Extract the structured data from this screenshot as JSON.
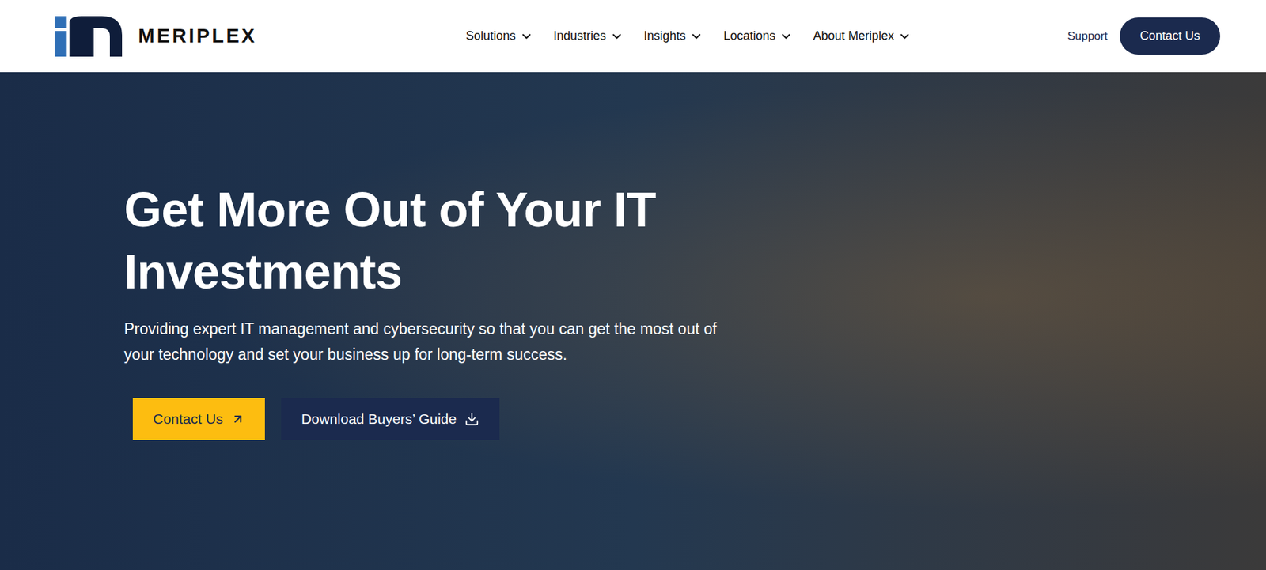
{
  "header": {
    "logo": {
      "name": "MERIPLEX"
    },
    "nav": [
      {
        "label": "Solutions"
      },
      {
        "label": "Industries"
      },
      {
        "label": "Insights"
      },
      {
        "label": "Locations"
      },
      {
        "label": "About Meriplex"
      }
    ],
    "support": "Support",
    "contact_button": "Contact Us"
  },
  "hero": {
    "heading_lines": [
      "Get More Out of Your IT",
      "Investments"
    ],
    "subtitle": "Providing expert IT management and cybersecurity so that you can get the most out of your technology and set your business up for long-term success.",
    "buttons": [
      {
        "label": "Contact Us",
        "kind": "primary"
      },
      {
        "label": "Download Buyers’ Guide",
        "kind": "secondary"
      }
    ]
  }
}
